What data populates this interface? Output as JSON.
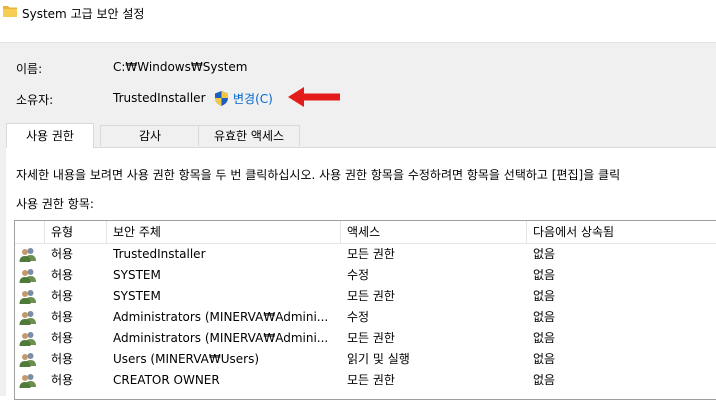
{
  "window": {
    "title": "System 고급 보안 설정",
    "folder_icon": "folder-icon"
  },
  "info": {
    "name_label": "이름:",
    "name_value": "C:₩Windows₩System",
    "owner_label": "소유자:",
    "owner_value": "TrustedInstaller",
    "change_link": "변경(C)",
    "change_icon": "uac-shield-icon",
    "pointer_icon": "red-arrow-icon"
  },
  "tabs": [
    {
      "label": "사용 권한",
      "active": true
    },
    {
      "label": "감사",
      "active": false
    },
    {
      "label": "유효한 액세스",
      "active": false
    }
  ],
  "permissions": {
    "description": "자세한 내용을 보려면 사용 권한 항목을 두 번 클릭하십시오. 사용 권한 항목을 수정하려면 항목을 선택하고 [편집]을 클릭",
    "entries_label": "사용 권한 항목:",
    "columns": [
      "유형",
      "보안 주체",
      "액세스",
      "다음에서 상속됨"
    ],
    "rows": [
      {
        "type": "허용",
        "principal": "TrustedInstaller",
        "access": "모든 권한",
        "inherited": "없음"
      },
      {
        "type": "허용",
        "principal": "SYSTEM",
        "access": "수정",
        "inherited": "없음"
      },
      {
        "type": "허용",
        "principal": "SYSTEM",
        "access": "모든 권한",
        "inherited": "없음"
      },
      {
        "type": "허용",
        "principal": "Administrators (MINERVA₩Admini...",
        "access": "수정",
        "inherited": "없음"
      },
      {
        "type": "허용",
        "principal": "Administrators (MINERVA₩Admini...",
        "access": "모든 권한",
        "inherited": "없음"
      },
      {
        "type": "허용",
        "principal": "Users (MINERVA₩Users)",
        "access": "읽기 및 실행",
        "inherited": "없음"
      },
      {
        "type": "허용",
        "principal": "CREATOR OWNER",
        "access": "모든 권한",
        "inherited": "없음"
      }
    ]
  },
  "colors": {
    "link": "#0066cc",
    "arrow": "#e31b1b",
    "panel_bg": "#f0f0f0"
  }
}
